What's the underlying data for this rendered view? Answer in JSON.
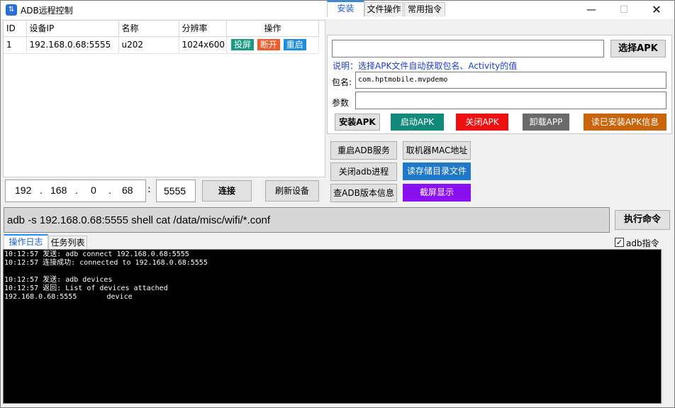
{
  "window": {
    "title": "ADB远程控制",
    "icon": "adb-app-icon",
    "min_glyph": "—",
    "max_glyph": "☐",
    "close_glyph": "✕"
  },
  "device_table": {
    "headers": [
      "ID",
      "设备IP",
      "名称",
      "分辨率",
      "操作"
    ],
    "rows": [
      {
        "id": "1",
        "ip": "192.168.0.68:5555",
        "name": "u202",
        "resolution": "1024x600",
        "actions": [
          "投屏",
          "断开",
          "重启"
        ]
      }
    ]
  },
  "connection": {
    "ip_parts": [
      "192",
      "168",
      "0",
      "68"
    ],
    "dot": ".",
    "colon": ":",
    "port": "5555",
    "connect_label": "连接",
    "refresh_label": "刷新设备"
  },
  "tabs": [
    "安装",
    "文件操作",
    "常用指令"
  ],
  "install": {
    "apk_path_value": "",
    "choose_apk_label": "选择APK",
    "hint": "说明：选择APK文件自动获取包名、Activity的值",
    "package_label": "包名:",
    "package_value": "com.hptmobile.mvpdemo",
    "params_label": "参数",
    "params_value": "",
    "buttons": [
      "安装APK",
      "启动APK",
      "关闭APK",
      "卸载APP",
      "读已安装APK信息"
    ]
  },
  "service_buttons": [
    "重启ADB服务",
    "取机器MAC地址",
    "关闭adb进程",
    "读存储目录文件",
    "查ADB版本信息",
    "截屏显示"
  ],
  "command": {
    "value": "adb -s 192.168.0.68:5555 shell cat /data/misc/wifi/*.conf",
    "execute_label": "执行命令",
    "adb_checkbox_label": "adb指令",
    "adb_checked": true
  },
  "log_tabs": [
    "操作日志",
    "任务列表"
  ],
  "log_lines": "10:12:57 发送: adb connect 192.168.0.68:5555\n10:12:57 连接成功: connected to 192.168.0.68:5555\n\n10:12:57 发送: adb devices\n10:12:57 返回: List of devices attached\n192.168.0.68:5555\tdevice",
  "colors": {
    "tag_green": "#1a9a80",
    "tag_orange": "#f35a2b",
    "tag_blue": "#1a8fe0",
    "start_apk": "#12897a",
    "close_apk": "#ee1111",
    "uninstall": "#6a6a6a",
    "read_apk": "#c8640c",
    "read_storage": "#1f78c8",
    "screenshot": "#8b10f0",
    "hint": "#1a3fd0"
  }
}
